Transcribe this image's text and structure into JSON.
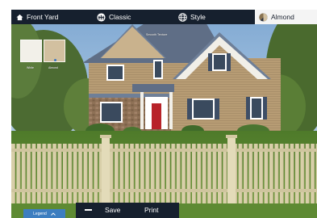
{
  "toolbar": {
    "view_label": "Front Yard",
    "series_label": "Classic",
    "style_label": "Style",
    "color_label": "Almond",
    "view_icon": "house-icon",
    "series_icon": "fence-badge-icon",
    "style_icon": "globe-icon",
    "color_icon": "color-swatch-icon"
  },
  "texture_panel": {
    "title": "Smooth Texture",
    "swatches": [
      {
        "label": "White",
        "color": "#f2f0e9",
        "selected": false
      },
      {
        "label": "Almond",
        "color": "#d2c0a0",
        "selected": true
      }
    ]
  },
  "bottom_bar": {
    "legend_label": "Legend",
    "save_label": "Save",
    "print_label": "Print"
  },
  "colors": {
    "toolbar_bg": "#16202e",
    "accent": "#3d7ec0",
    "fence": "#d8cfa9"
  }
}
